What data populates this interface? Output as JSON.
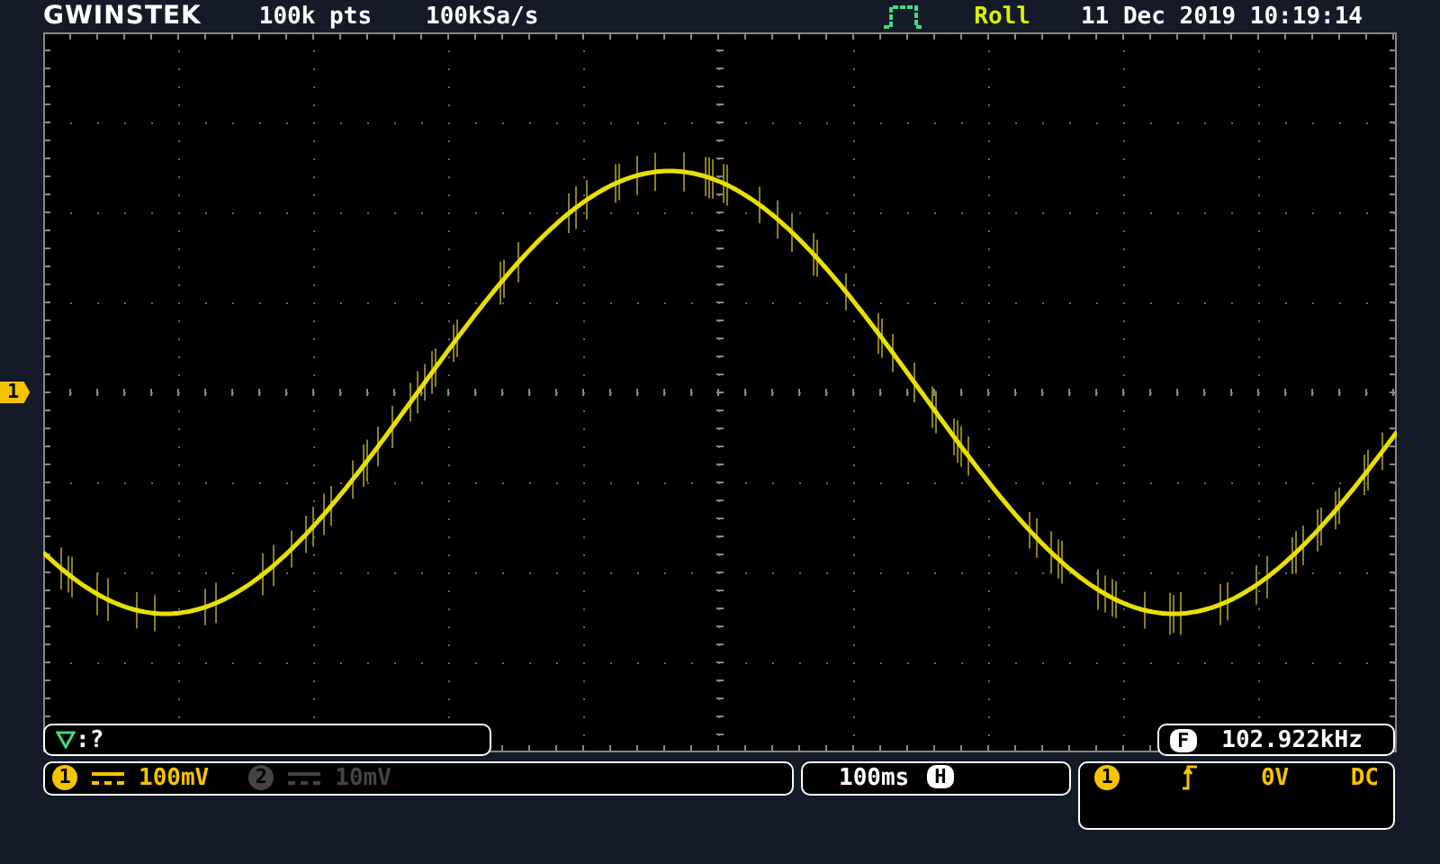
{
  "header": {
    "brand": "GWINSTEK",
    "record_length": "100k pts",
    "sample_rate": "100kSa/s",
    "mode": "Roll",
    "datetime": "11 Dec 2019 10:19:14"
  },
  "channel_marker": "1",
  "trigger_status": {
    "text": ":?"
  },
  "frequency_counter": {
    "badge": "F",
    "value": "102.922kHz"
  },
  "channels": [
    {
      "number": "1",
      "scale": "100mV",
      "active": true
    },
    {
      "number": "2",
      "scale": "10mV",
      "active": false
    }
  ],
  "timebase": {
    "value": "100ms",
    "badge": "H"
  },
  "trigger": {
    "source": "1",
    "level": "0V",
    "coupling": "DC"
  }
}
